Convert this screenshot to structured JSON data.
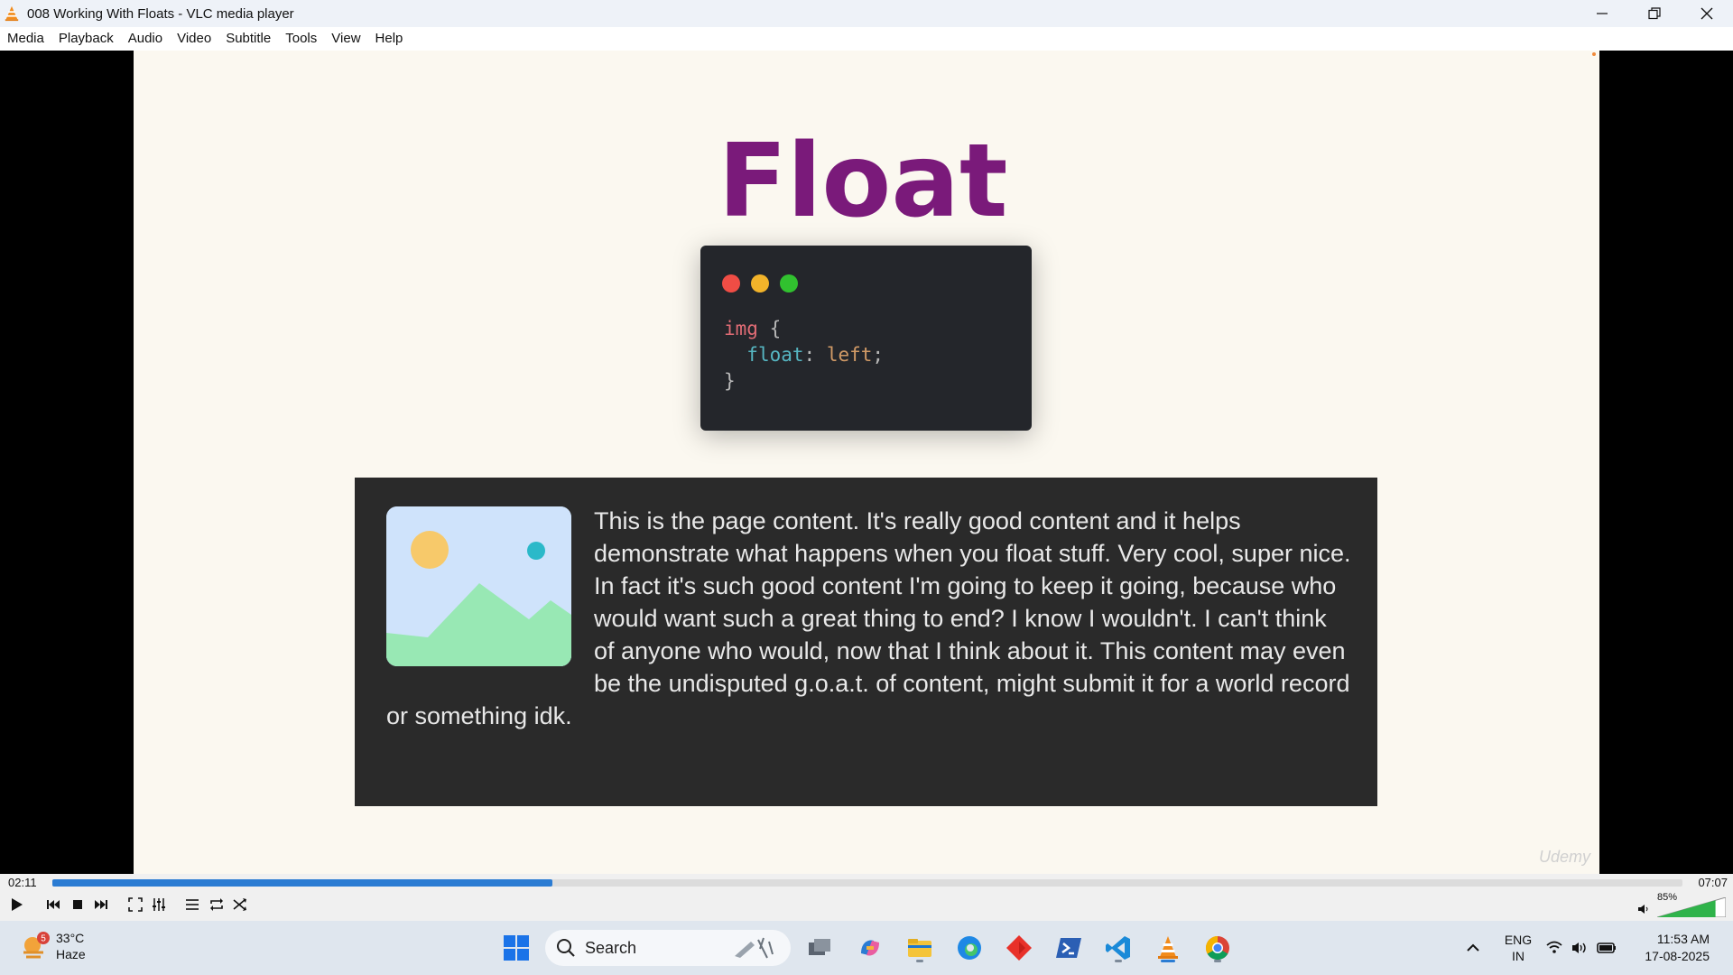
{
  "window": {
    "title": "008 Working With Floats - VLC media player",
    "app_icon": "vlc-cone-icon"
  },
  "menu": [
    "Media",
    "Playback",
    "Audio",
    "Video",
    "Subtitle",
    "Tools",
    "View",
    "Help"
  ],
  "slide": {
    "title": "Float",
    "code": {
      "selector": "img",
      "open_brace": " {",
      "property": "float",
      "colon": ": ",
      "value": "left",
      "semicolon": ";",
      "close_brace": "}"
    },
    "demo_text": "This is the page content. It's really good content and it helps demonstrate what happens when you float stuff. Very cool, super nice. In fact it's such good content I'm going to keep it going, because who would want such a great thing to end? I know I wouldn't. I can't think of anyone who would, now that I think about it. This content may even be the undisputed g.o.a.t. of content, might submit it for a world record or something idk.",
    "watermark": "Udemy"
  },
  "player": {
    "current_time": "02:11",
    "total_time": "07:07",
    "progress_fraction": 0.307,
    "volume_label": "85%",
    "volume_fraction": 0.85
  },
  "taskbar": {
    "weather_temp": "33°C",
    "weather_desc": "Haze",
    "weather_badge": "5",
    "search_label": "Search",
    "lang_top": "ENG",
    "lang_bottom": "IN",
    "time": "11:53 AM",
    "date": "17-08-2025"
  },
  "colors": {
    "slide_title": "#7a1a7a",
    "progress": "#2b7cd3",
    "volume": "#2fb34a"
  }
}
